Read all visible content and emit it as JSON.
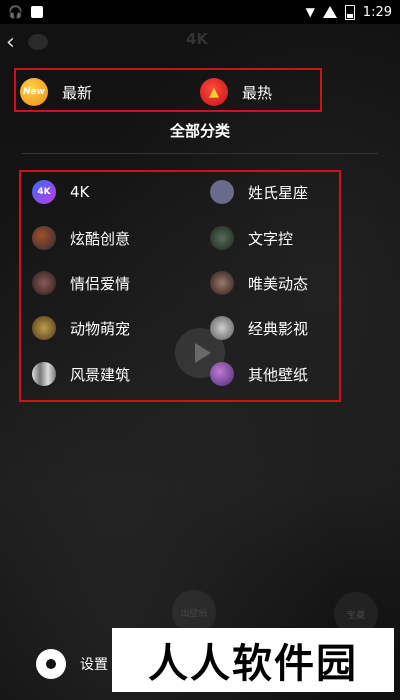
{
  "status_bar": {
    "time": "1:29"
  },
  "header": {
    "title": "4K"
  },
  "top_tabs": [
    {
      "label": "最新",
      "icon_text": "New",
      "icon": "new-badge-icon"
    },
    {
      "label": "最热",
      "icon": "fire-icon"
    }
  ],
  "section": {
    "title": "全部分类"
  },
  "categories": [
    {
      "label": "4K",
      "icon_text": "4K",
      "color": "#5b3be0"
    },
    {
      "label": "姓氏星座",
      "color": "#6a6a8a"
    },
    {
      "label": "炫酷创意",
      "color": "#7a3a2a"
    },
    {
      "label": "文字控",
      "color": "#3a4a3a"
    },
    {
      "label": "情侣爱情",
      "color": "#6a4a4a"
    },
    {
      "label": "唯美动态",
      "color": "#5a4a40"
    },
    {
      "label": "动物萌宠",
      "color": "#8a6a30"
    },
    {
      "label": "经典影视",
      "color": "#707070"
    },
    {
      "label": "风景建筑",
      "color": "#9a9a9a"
    },
    {
      "label": "其他壁纸",
      "color": "#7a4aa0"
    }
  ],
  "background": {
    "left_button_text": "出壁纸",
    "right_button_text": "宝藏"
  },
  "settings": {
    "label": "设置"
  },
  "watermark": {
    "text": "人人软件园"
  }
}
